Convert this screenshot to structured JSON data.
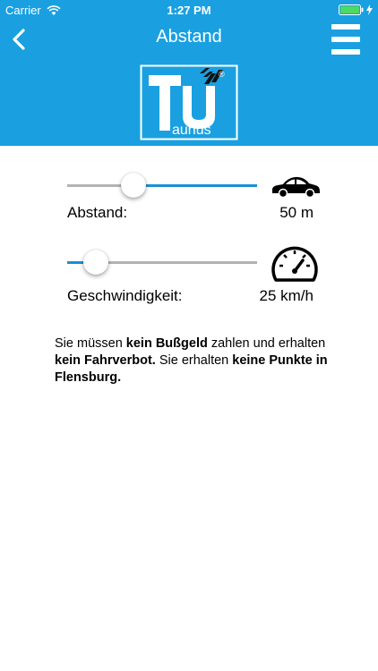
{
  "status_bar": {
    "carrier": "Carrier",
    "time": "1:27 PM"
  },
  "nav": {
    "title": "Abstand",
    "back_icon": "chevron-left-icon",
    "menu_icon": "hamburger-menu-icon"
  },
  "logo": {
    "letters_main": "TU",
    "letters_sub": "aunus",
    "registered": "®"
  },
  "distance": {
    "label": "Abstand:",
    "value": "50 m",
    "slider_level": 0.35,
    "icon": "car-icon"
  },
  "speed": {
    "label": "Geschwindigkeit:",
    "value": "25 km/h",
    "slider_level": 0.15,
    "icon": "speedometer-icon"
  },
  "result": {
    "p1": "Sie müssen ",
    "b1": "kein Bußgeld",
    "p2": " zahlen und erhalten ",
    "b2": "kein Fahrverbot.",
    "p3": " Sie erhalten ",
    "b3": "keine Punkte in Flensburg."
  },
  "colors": {
    "brand_blue": "#1aa0e0",
    "slider_blue": "#1a8fd6",
    "slider_gray": "#b3b3b3"
  }
}
